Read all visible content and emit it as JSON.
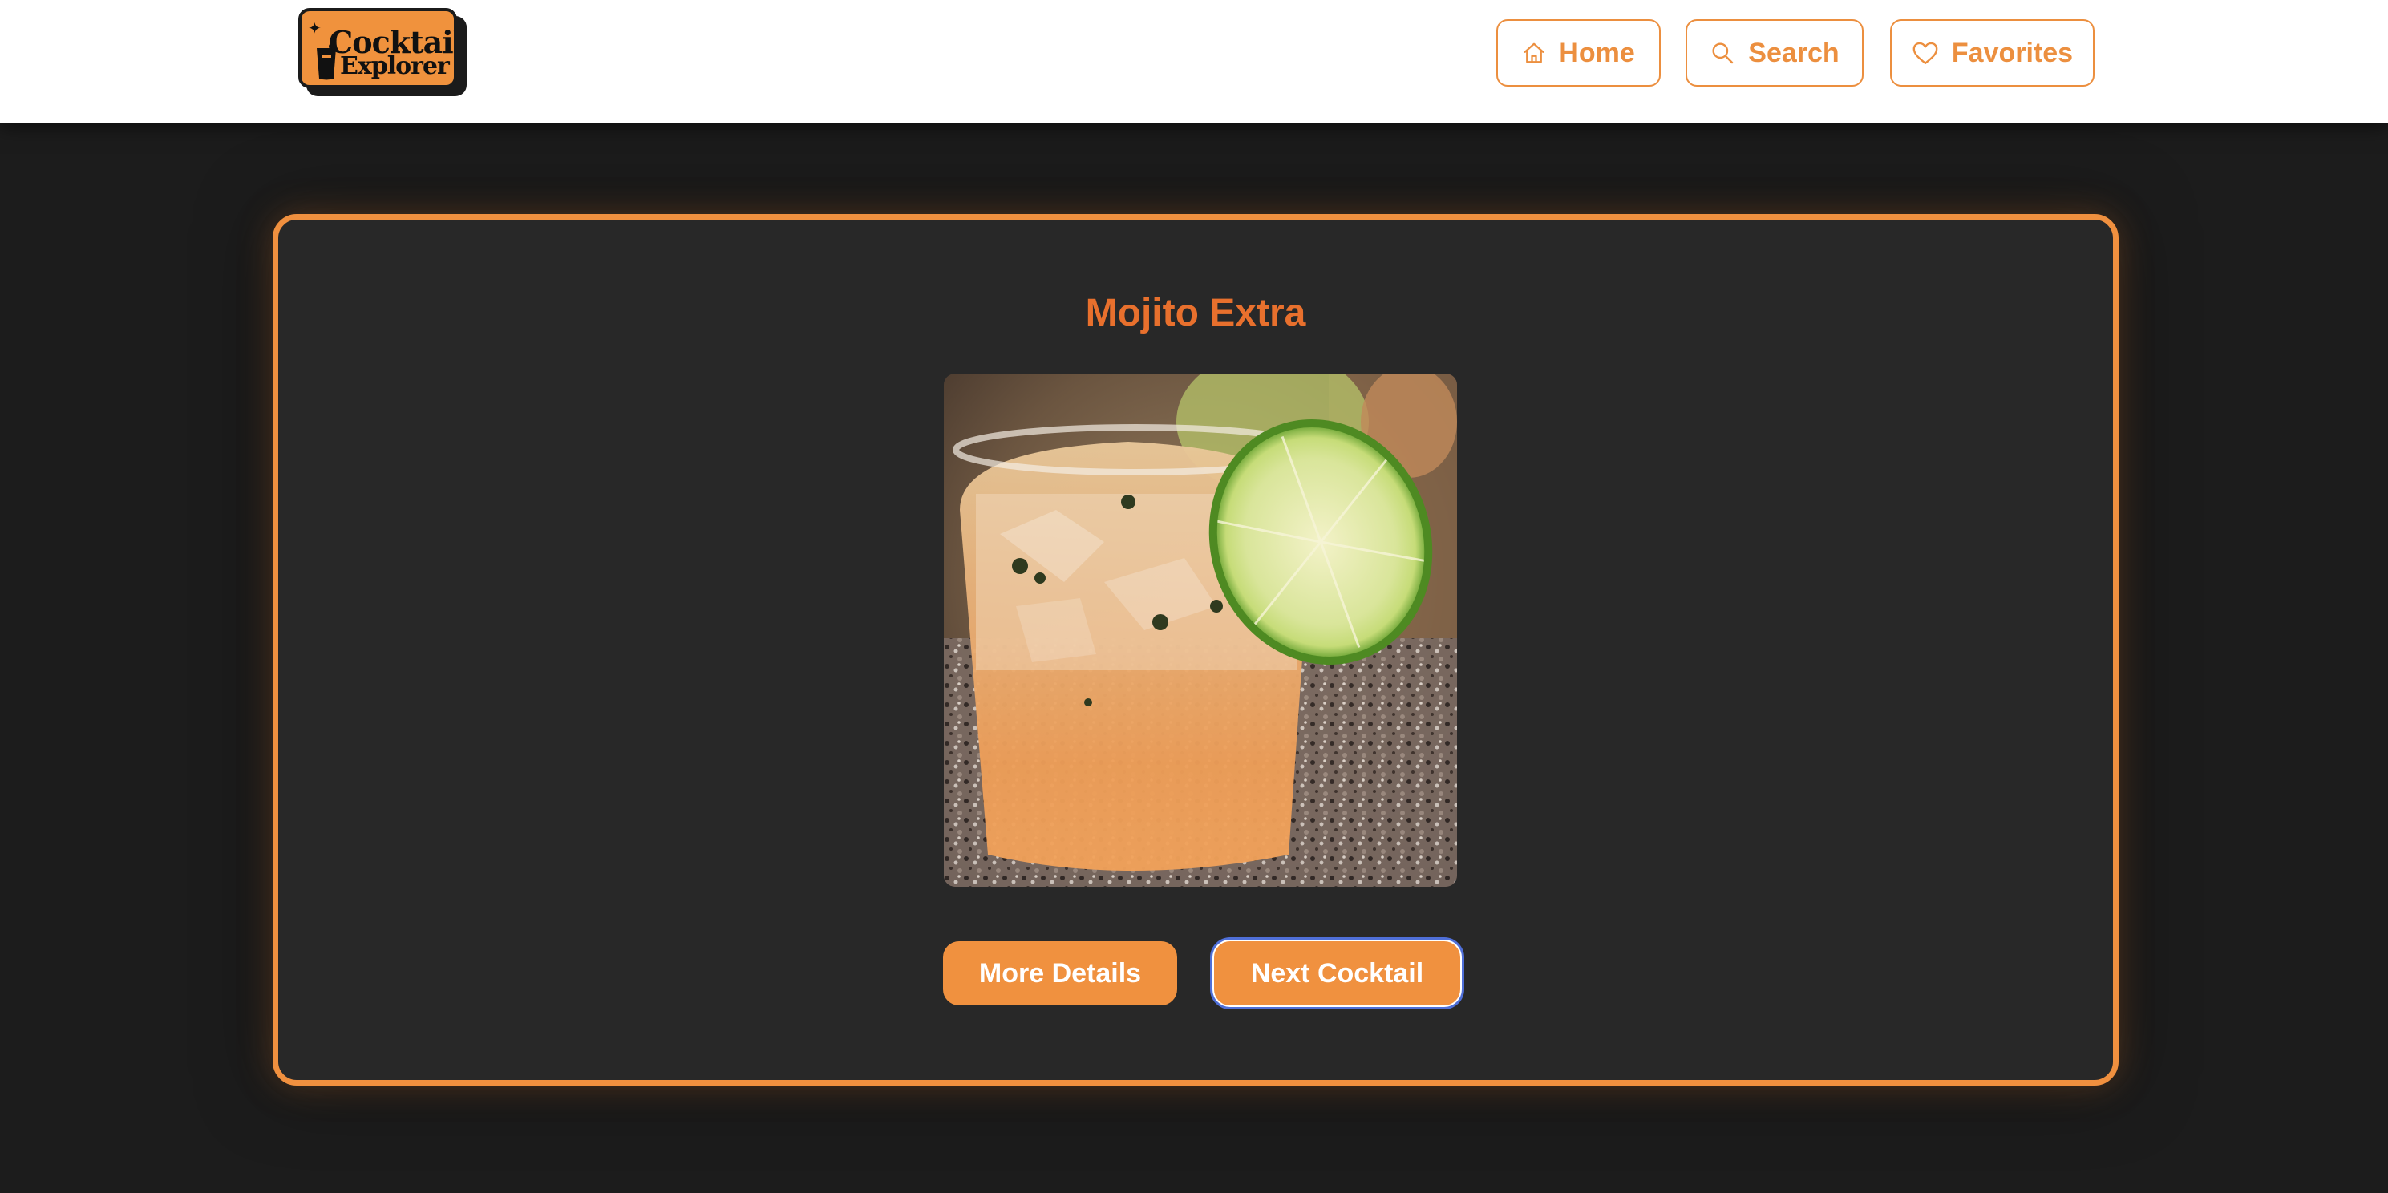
{
  "header": {
    "logo": {
      "line1": "Cocktail",
      "line2": "Explorer"
    },
    "nav": [
      {
        "label": "Home",
        "icon": "home-icon"
      },
      {
        "label": "Search",
        "icon": "search-icon"
      },
      {
        "label": "Favorites",
        "icon": "heart-icon"
      }
    ]
  },
  "cocktail": {
    "name": "Mojito Extra",
    "image_alt": "Mojito Extra"
  },
  "actions": {
    "details_label": "More Details",
    "next_label": "Next Cocktail"
  },
  "colors": {
    "accent": "#f0913f",
    "title": "#e8702d",
    "page_background": "#1c1c1c",
    "card_background": "#282828",
    "header_background": "#ffffff",
    "focus_ring": "#4f6fd8"
  }
}
